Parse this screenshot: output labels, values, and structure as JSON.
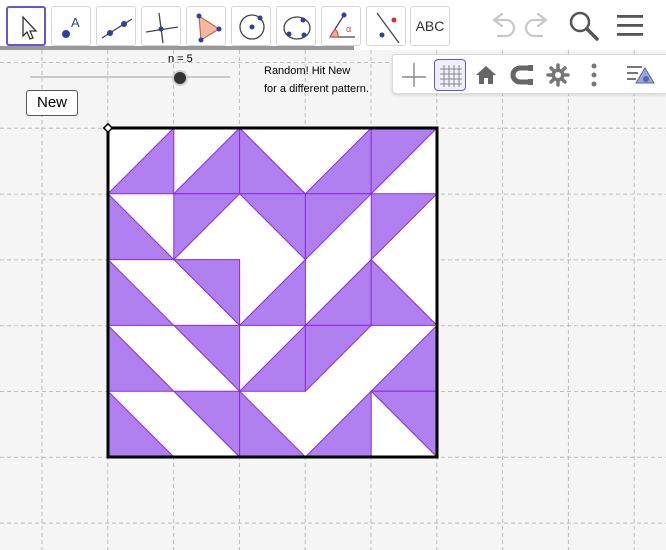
{
  "toolbar": {
    "tools": [
      {
        "name": "move-tool",
        "icon": "arrow-cursor-icon"
      },
      {
        "name": "point-tool",
        "icon": "point-icon"
      },
      {
        "name": "line-tool",
        "icon": "line-icon"
      },
      {
        "name": "perpendicular-tool",
        "icon": "perpendicular-line-icon"
      },
      {
        "name": "polygon-tool",
        "icon": "polygon-icon"
      },
      {
        "name": "circle-tool",
        "icon": "circle-center-point-icon"
      },
      {
        "name": "conic-tool",
        "icon": "circle-three-points-icon"
      },
      {
        "name": "angle-tool",
        "icon": "angle-icon"
      },
      {
        "name": "reflect-tool",
        "icon": "reflect-about-line-icon"
      },
      {
        "name": "text-tool",
        "label": "ABC"
      }
    ]
  },
  "header": {
    "undo_icon": "undo-icon",
    "redo_icon": "redo-icon",
    "search_icon": "search-icon",
    "menu_icon": "menu-icon"
  },
  "style_bar": {
    "buttons": [
      "axes-icon",
      "grid-icon",
      "home-icon",
      "magnet-icon",
      "gear-icon",
      "more-vertical-icon",
      "algebra-view-icon"
    ]
  },
  "slider": {
    "label": "n = 5",
    "value": 5
  },
  "new_button": {
    "label": "New"
  },
  "note": {
    "line1": "Random! Hit New",
    "line2": "for a different pattern."
  },
  "colors": {
    "accent": "#6557d2",
    "fill": "#b07ff0",
    "edge": "#8a2be2",
    "grid": "#bdbdbd",
    "canvas": "#f5f5f5"
  },
  "quilt": {
    "n": 5,
    "rows": [
      [
        "BR",
        "BR",
        "BL",
        "BR",
        "TL"
      ],
      [
        "BL",
        "TL",
        "TR",
        "TL",
        "TL"
      ],
      [
        "BL",
        "TR",
        "BR",
        "BR",
        "BL"
      ],
      [
        "BL",
        "TR",
        "BR",
        "TL",
        "BR"
      ],
      [
        "BL",
        "TR",
        "BL",
        "BR",
        "TR"
      ]
    ]
  }
}
